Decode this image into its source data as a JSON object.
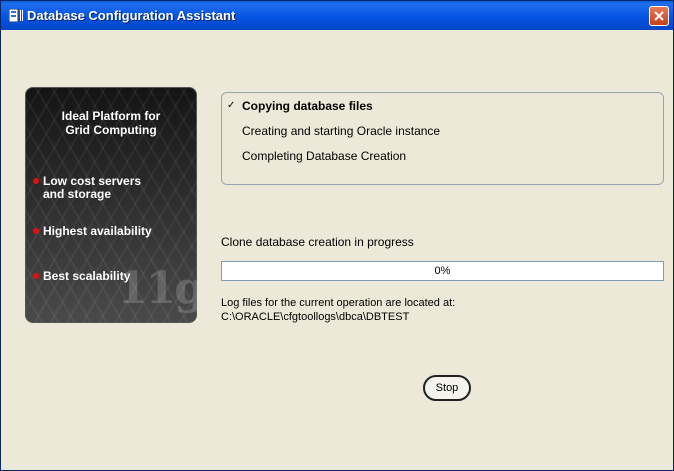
{
  "window": {
    "title": "Database Configuration Assistant"
  },
  "brand": {
    "title_line1": "Ideal Platform for",
    "title_line2": "Grid Computing",
    "bullets": [
      {
        "line1": "Low cost servers",
        "line2": "and storage"
      },
      {
        "line1": "Highest availability"
      },
      {
        "line1": "Best scalability"
      }
    ],
    "logo": "11g"
  },
  "steps": [
    {
      "label": "Copying database files",
      "status": "in-progress"
    },
    {
      "label": "Creating and starting Oracle instance",
      "status": "pending"
    },
    {
      "label": "Completing Database Creation",
      "status": "pending"
    }
  ],
  "progress": {
    "label": "Clone database creation in progress",
    "value": 0,
    "text": "0%"
  },
  "log": {
    "line1": "Log files for the current operation are located at:",
    "line2": "C:\\ORACLE\\cfgtoollogs\\dbca\\DBTEST"
  },
  "buttons": {
    "stop": "Stop"
  },
  "colors": {
    "titlebar": "#0554e3",
    "bullet": "#e01010",
    "close": "#c4401b",
    "background": "#ece9d8"
  }
}
